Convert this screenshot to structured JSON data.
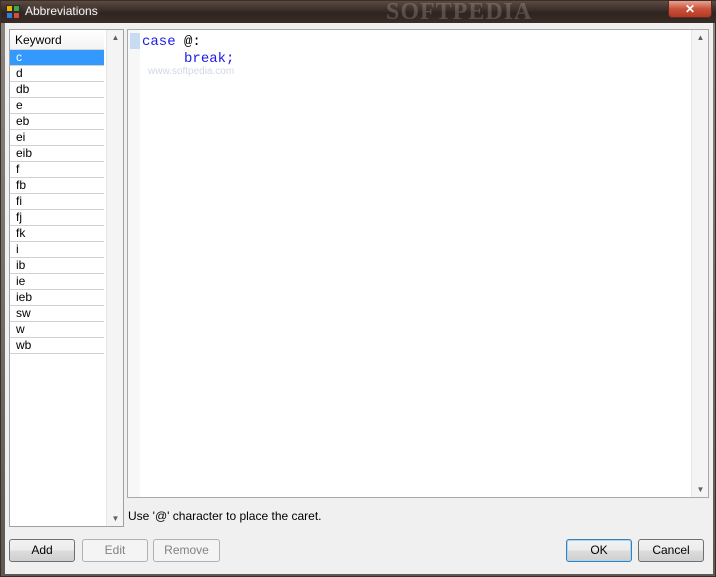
{
  "window": {
    "title": "Abbreviations",
    "brand_watermark": "SOFTPEDIA",
    "close_label": "✕"
  },
  "keywords": {
    "header": "Keyword",
    "items": [
      "c",
      "d",
      "db",
      "e",
      "eb",
      "ei",
      "eib",
      "f",
      "fb",
      "fi",
      "fj",
      "fk",
      "i",
      "ib",
      "ie",
      "ieb",
      "sw",
      "w",
      "wb"
    ],
    "selected": "c"
  },
  "editor": {
    "line1_keyword": "case",
    "line1_rest": " @:",
    "line2_indent": "     ",
    "line2_keyword": "break",
    "line2_rest": ";",
    "watermark": "www.softpedia.com"
  },
  "hint": "Use '@' character to place the caret.",
  "buttons": {
    "add": "Add",
    "edit": "Edit",
    "remove": "Remove",
    "ok": "OK",
    "cancel": "Cancel"
  },
  "colors": {
    "selection": "#3399ff",
    "code_keyword": "#1a1ae6",
    "close_button": "#c9513a"
  }
}
